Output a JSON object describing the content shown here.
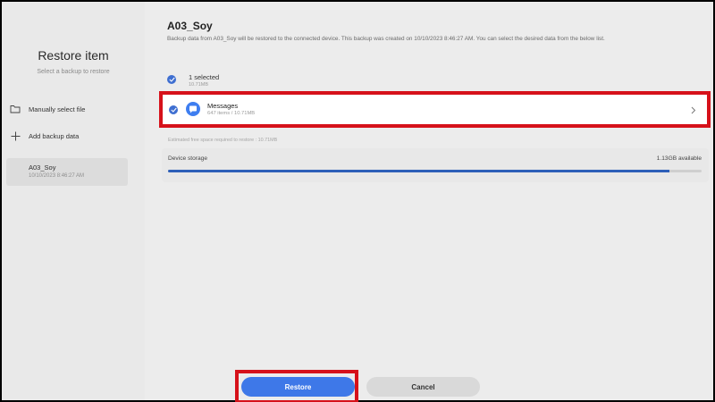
{
  "sidebar": {
    "title": "Restore item",
    "subtitle": "Select a backup to restore",
    "actions": [
      {
        "label": "Manually select file",
        "icon": "folder-icon"
      },
      {
        "label": "Add backup data",
        "icon": "plus-icon"
      }
    ],
    "backup": {
      "name": "A03_Soy",
      "date": "10/10/2023 8:46:27 AM"
    }
  },
  "main": {
    "title": "A03_Soy",
    "description": "Backup data from A03_Soy will be restored to the connected device. This backup was created on 10/10/2023 8:46:27 AM. You can select the desired data from the below list.",
    "selection": {
      "count_label": "1 selected",
      "size": "10.71MB"
    },
    "item": {
      "name": "Messages",
      "meta": "647 items / 10.71MB",
      "icon": "messages-icon",
      "color": "#3e7ef0"
    },
    "estimate": "Estimated free space required to restore : 10.71MB",
    "storage": {
      "label": "Device storage",
      "available": "1.13GB available",
      "used_fraction": 0.94
    }
  },
  "buttons": {
    "restore": "Restore",
    "cancel": "Cancel"
  },
  "colors": {
    "accent": "#3e78e8",
    "highlight": "#d6111a"
  }
}
